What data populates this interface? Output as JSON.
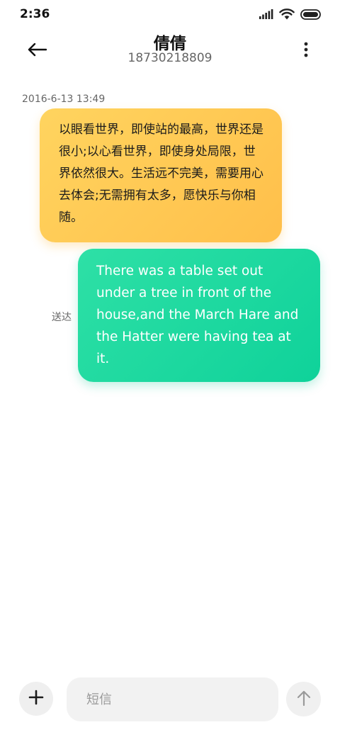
{
  "status_bar": {
    "time": "2:36",
    "icons": [
      "signal-icon",
      "wifi-icon",
      "battery-icon"
    ]
  },
  "header": {
    "back_icon": "arrow-left-icon",
    "contact_name": "倩倩",
    "contact_number": "18730218809",
    "more_icon": "more-vertical-icon"
  },
  "conversation": {
    "timestamp": "2016-6-13 13:49",
    "incoming_message": {
      "text": "以眼看世界，即使站的最高，世界还是很小;以心看世界，即使身处局限，世界依然很大。生活远不完美，需要用心去体会;无需拥有太多，愿快乐与你相随。",
      "colors": [
        "#ffd45f",
        "#ffbf4a"
      ]
    },
    "outgoing_message": {
      "text": "There was a table set out under a tree in front of the house,and the March Hare and the Hatter were having tea at it.",
      "status": "送达",
      "colors": [
        "#2ee0a6",
        "#0fd29a"
      ]
    }
  },
  "composer": {
    "add_icon": "plus-icon",
    "placeholder": "短信",
    "value": "",
    "send_icon": "arrow-up-icon"
  }
}
